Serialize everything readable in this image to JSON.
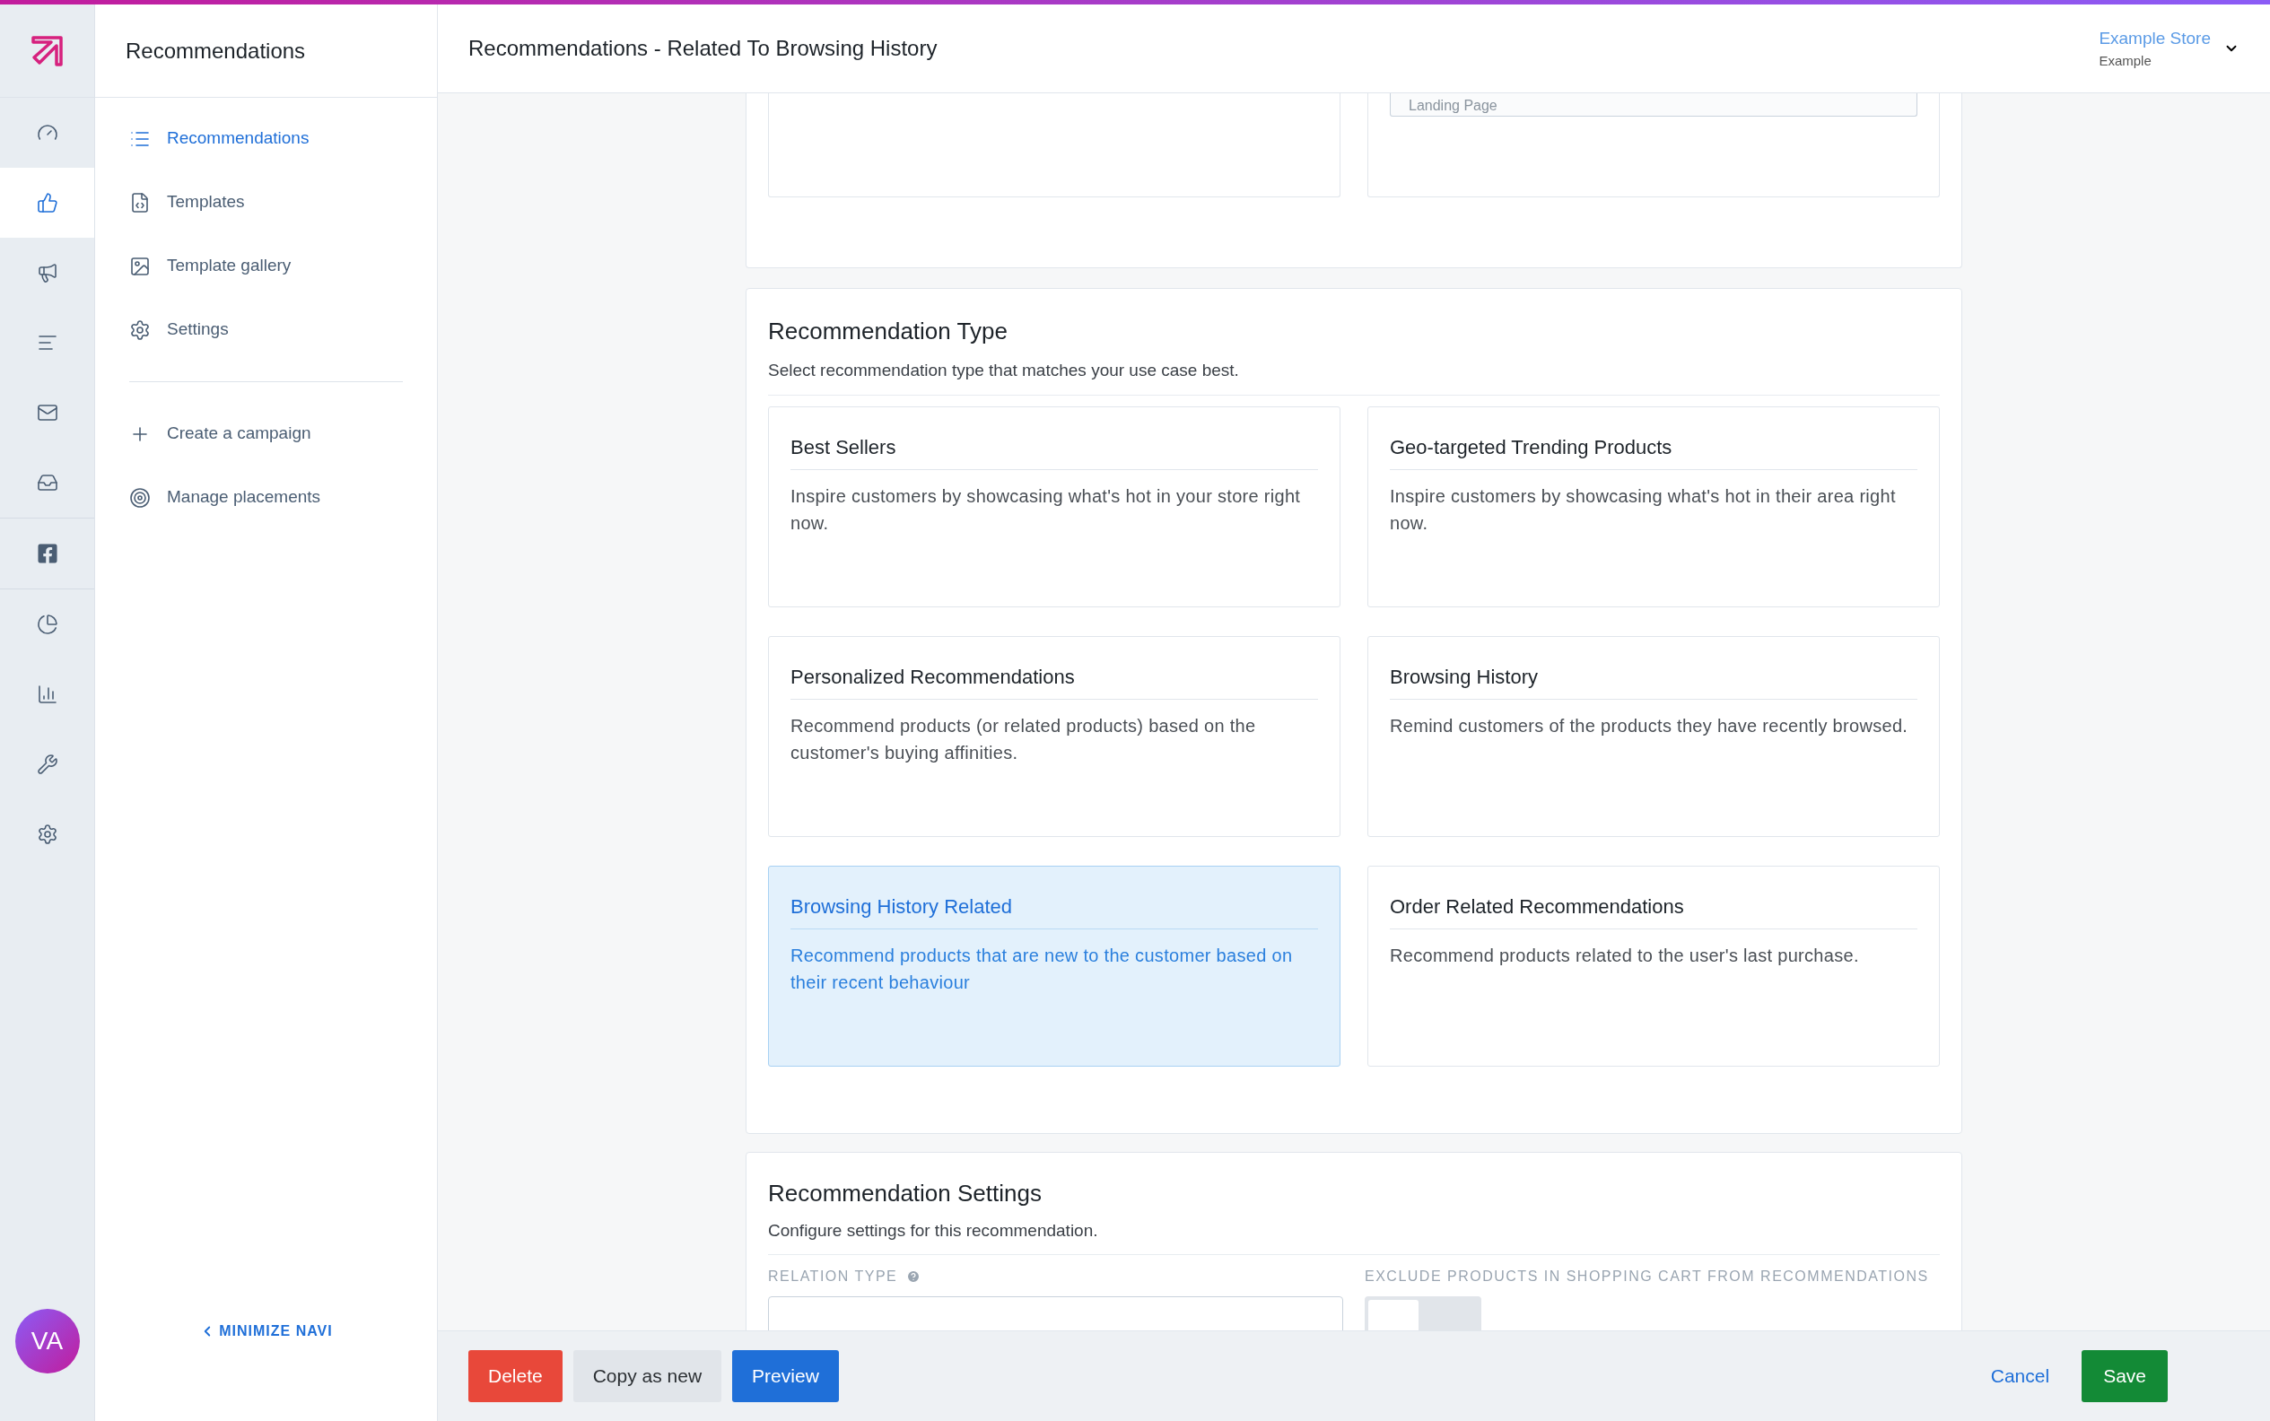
{
  "rail": {
    "items": [
      {
        "selected": false
      },
      {
        "selected": true
      },
      {
        "selected": false
      },
      {
        "selected": false
      },
      {
        "selected": false
      },
      {
        "selected": false
      },
      {
        "selected": false
      },
      {
        "selected": false
      },
      {
        "selected": false
      },
      {
        "selected": false
      },
      {
        "selected": false
      }
    ]
  },
  "avatar": {
    "initials": "VA"
  },
  "sidebar": {
    "title": "Recommendations",
    "items": [
      {
        "label": "Recommendations",
        "selected": true
      },
      {
        "label": "Templates",
        "selected": false
      },
      {
        "label": "Template gallery",
        "selected": false
      },
      {
        "label": "Settings",
        "selected": false
      }
    ],
    "actions": [
      {
        "label": "Create a campaign"
      },
      {
        "label": "Manage placements"
      }
    ],
    "minimize": "MINIMIZE NAVI"
  },
  "header": {
    "title": "Recommendations - Related To Browsing History",
    "store": {
      "name": "Example Store",
      "account": "Example"
    }
  },
  "previous_section": {
    "field_value": "Landing Page"
  },
  "recommendation_type": {
    "title": "Recommendation Type",
    "subtitle": "Select recommendation type that matches your use case best.",
    "options": [
      {
        "title": "Best Sellers",
        "description": "Inspire customers by showcasing what's hot in your store right now.",
        "selected": false
      },
      {
        "title": "Geo-targeted Trending Products",
        "description": "Inspire customers by showcasing what's hot in their area right now.",
        "selected": false
      },
      {
        "title": "Personalized Recommendations",
        "description": "Recommend products (or related products) based on the customer's buying affinities.",
        "selected": false
      },
      {
        "title": "Browsing History",
        "description": "Remind customers of the products they have recently browsed.",
        "selected": false
      },
      {
        "title": "Browsing History Related",
        "description": "Recommend products that are new to the customer based on their recent behaviour",
        "selected": true
      },
      {
        "title": "Order Related Recommendations",
        "description": "Recommend products related to the user's last purchase.",
        "selected": false
      }
    ]
  },
  "recommendation_settings": {
    "title": "Recommendation Settings",
    "subtitle": "Configure settings for this recommendation.",
    "fields": [
      {
        "label": "RELATION TYPE",
        "kind": "select",
        "help": true
      },
      {
        "label": "EXCLUDE PRODUCTS IN SHOPPING CART FROM RECOMMENDATIONS",
        "kind": "toggle",
        "help": false,
        "on": false
      }
    ]
  },
  "footer": {
    "left_buttons": [
      {
        "label": "Delete",
        "kind": "danger"
      },
      {
        "label": "Copy as new",
        "kind": "secondary"
      },
      {
        "label": "Preview",
        "kind": "primary"
      }
    ],
    "cancel": "Cancel",
    "save": "Save"
  }
}
